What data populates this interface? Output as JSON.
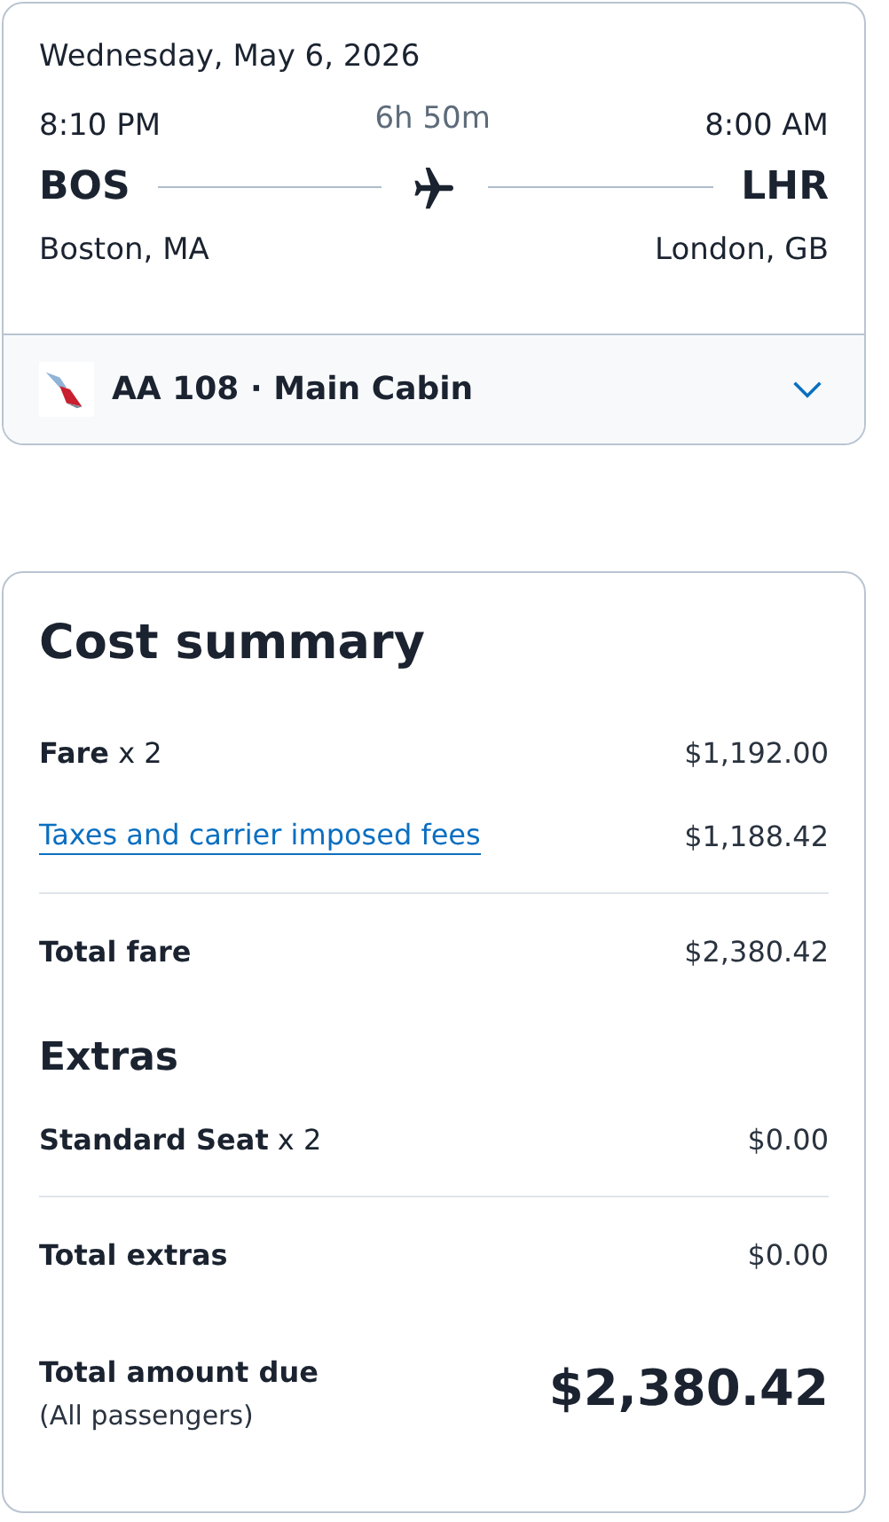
{
  "flight": {
    "date": "Wednesday, May 6, 2026",
    "departure": {
      "time": "8:10 PM",
      "code": "BOS",
      "city": "Boston, MA"
    },
    "duration": "6h 50m",
    "arrival": {
      "time": "8:00 AM",
      "code": "LHR",
      "city": "London, GB"
    },
    "segment": {
      "label": "AA 108 · Main Cabin",
      "expanded": false
    }
  },
  "cost_summary": {
    "title": "Cost summary",
    "fare_lines": [
      {
        "kind": "text",
        "label": "**Fare** x 2",
        "amount": "$1,192.00"
      },
      {
        "kind": "link",
        "label": "Taxes and carrier imposed fees",
        "amount": "$1,188.42"
      }
    ],
    "fare_total": {
      "label": "Total fare",
      "amount": "$2,380.42"
    },
    "extras_title": "Extras",
    "extras_lines": [
      {
        "kind": "text",
        "label": "**Standard Seat** x 2",
        "amount": "$0.00"
      }
    ],
    "extras_total": {
      "label": "Total extras",
      "amount": "$0.00"
    },
    "amount_due": {
      "label": "Total amount due",
      "note": "(All passengers)",
      "amount": "$2,380.42"
    }
  }
}
